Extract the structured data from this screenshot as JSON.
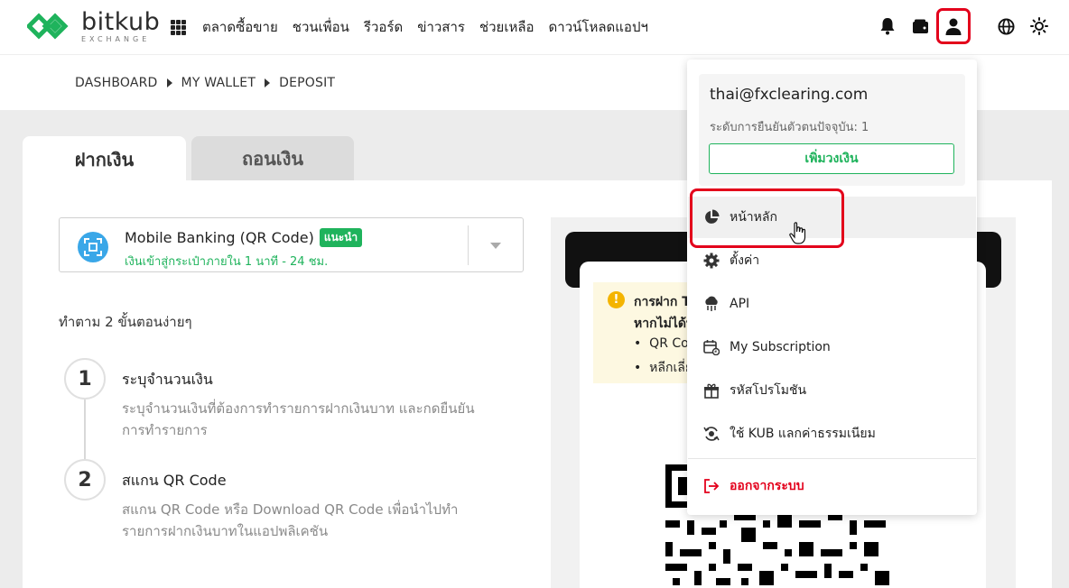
{
  "header": {
    "logo_text": "bitkub",
    "logo_sub": "EXCHANGE",
    "nav": [
      "ตลาดซื้อขาย",
      "ชวนเพื่อน",
      "รีวอร์ด",
      "ข่าวสาร",
      "ช่วยเหลือ",
      "ดาวน์โหลดแอปฯ"
    ],
    "icons": [
      "apps-icon",
      "bell-icon",
      "wallet-icon",
      "user-icon",
      "globe-icon",
      "sun-icon"
    ]
  },
  "breadcrumb": [
    "DASHBOARD",
    "MY WALLET",
    "DEPOSIT"
  ],
  "tabs": {
    "deposit": "ฝากเงิน",
    "withdraw": "ถอนเงิน"
  },
  "method": {
    "title": "Mobile Banking (QR Code)",
    "badge": "แนะนำ",
    "subtitle": "เงินเข้าสู่กระเป๋าภายใน 1 นาที - 24 ชม."
  },
  "steps": {
    "title": "ทำตาม 2 ขั้นตอนง่ายๆ",
    "items": [
      {
        "number": "1",
        "heading": "ระบุจำนวนเงิน",
        "desc": "ระบุจำนวนเงินที่ต้องการทำรายการฝากเงินบาท และกดยืนยันการทำรายการ"
      },
      {
        "number": "2",
        "heading": "สแกน QR Code",
        "desc": "สแกน QR Code หรือ Download QR Code เพื่อนำไปทำรายการฝากเงินบาทในแอปพลิเคชัน"
      }
    ]
  },
  "notice": {
    "line1": "การฝาก T",
    "line2": "หากไม่ได้ท",
    "bullet1": "QR Coc",
    "bullet2": "หลีกเลี่ย"
  },
  "account_menu": {
    "email": "thai@fxclearing.com",
    "level": "ระดับการยืนยันตัวตนปัจจุบัน: 1",
    "increase_limit": "เพิ่มวงเงิน",
    "items": [
      {
        "label": "หน้าหลัก",
        "icon": "pie-chart-icon"
      },
      {
        "label": "ตั้งค่า",
        "icon": "gear-icon"
      },
      {
        "label": "API",
        "icon": "api-icon"
      },
      {
        "label": "My Subscription",
        "icon": "calendar-icon"
      },
      {
        "label": "รหัสโปรโมชัน",
        "icon": "gift-icon"
      },
      {
        "label": "ใช้ KUB แลกค่าธรรมเนียม",
        "icon": "exchange-icon"
      }
    ],
    "logout": "ออกจากระบบ"
  },
  "colors": {
    "brand_green": "#1fb35c",
    "highlight_red": "#e3001b"
  }
}
